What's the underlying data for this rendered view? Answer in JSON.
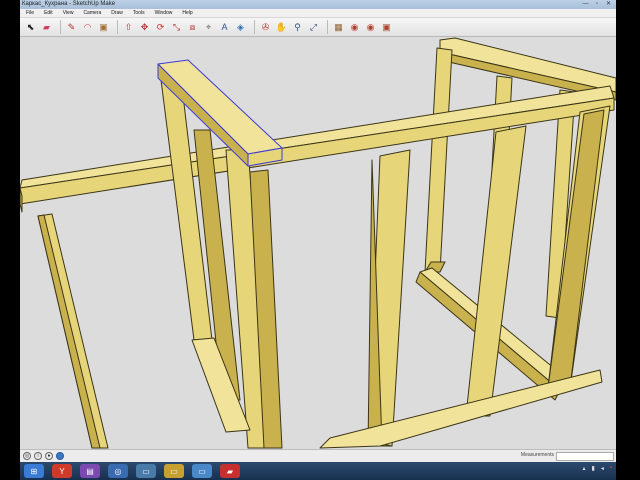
{
  "app": {
    "title": "Каркас_Кухрана - SketchUp Make",
    "window_controls": "— ▫ ✕"
  },
  "menu": [
    "File",
    "Edit",
    "View",
    "Camera",
    "Draw",
    "Tools",
    "Window",
    "Help"
  ],
  "toolbar": {
    "tools": [
      {
        "name": "select-tool",
        "glyph": "⬉",
        "color": "#222222"
      },
      {
        "name": "eraser-tool",
        "glyph": "▰",
        "color": "#d04060"
      },
      {
        "name": "line-tool",
        "glyph": "✎",
        "color": "#b03030"
      },
      {
        "name": "arc-tool",
        "glyph": "◠",
        "color": "#c04040"
      },
      {
        "name": "shapes-tool",
        "glyph": "▣",
        "color": "#a07030"
      },
      {
        "name": "pushpull-tool",
        "glyph": "⇧",
        "color": "#c03030"
      },
      {
        "name": "move-tool",
        "glyph": "✥",
        "color": "#c03030"
      },
      {
        "name": "rotate-tool",
        "glyph": "⟳",
        "color": "#c03030"
      },
      {
        "name": "scale-tool",
        "glyph": "⤡",
        "color": "#c03030"
      },
      {
        "name": "offset-tool",
        "glyph": "⧈",
        "color": "#c03030"
      },
      {
        "name": "tape-measure-tool",
        "glyph": "⌖",
        "color": "#707070"
      },
      {
        "name": "text-tool",
        "glyph": "A",
        "color": "#3050a0"
      },
      {
        "name": "paint-bucket-tool",
        "glyph": "◈",
        "color": "#3070b0"
      },
      {
        "name": "orbit-tool",
        "glyph": "✇",
        "color": "#c03030"
      },
      {
        "name": "pan-tool",
        "glyph": "✋",
        "color": "#806040"
      },
      {
        "name": "zoom-tool",
        "glyph": "⚲",
        "color": "#305080"
      },
      {
        "name": "zoom-extents-tool",
        "glyph": "⤢",
        "color": "#305080"
      },
      {
        "name": "warehouse-button",
        "glyph": "▦",
        "color": "#906030"
      },
      {
        "name": "share-model-button",
        "glyph": "◉",
        "color": "#b04030"
      },
      {
        "name": "extension-warehouse-button",
        "glyph": "◉",
        "color": "#b04030"
      },
      {
        "name": "layout-button",
        "glyph": "▣",
        "color": "#b04030"
      }
    ]
  },
  "statusbar": {
    "measurements_label": "Measurements"
  },
  "taskbar": {
    "apps": [
      {
        "name": "start-button",
        "glyph": "⊞",
        "color": "#3a7bd5"
      },
      {
        "name": "yandex-browser-taskbar",
        "glyph": "Y",
        "color": "#d03a2a"
      },
      {
        "name": "media-player-taskbar",
        "glyph": "▤",
        "color": "#7a4ab0"
      },
      {
        "name": "network-taskbar",
        "glyph": "◎",
        "color": "#3a6ab0"
      },
      {
        "name": "explorer-taskbar",
        "glyph": "▭",
        "color": "#4a7aa8"
      },
      {
        "name": "folder-taskbar",
        "glyph": "▭",
        "color": "#c8a030"
      },
      {
        "name": "documents-taskbar",
        "glyph": "▭",
        "color": "#4a88c8"
      },
      {
        "name": "sketchup-taskbar",
        "glyph": "▰",
        "color": "#c83030"
      }
    ]
  },
  "colors": {
    "wood_face": "#e7d57a",
    "wood_top": "#f1e39a",
    "wood_side": "#c9b24e",
    "edge": "#3b3517",
    "selection": "#3b3bd8"
  }
}
